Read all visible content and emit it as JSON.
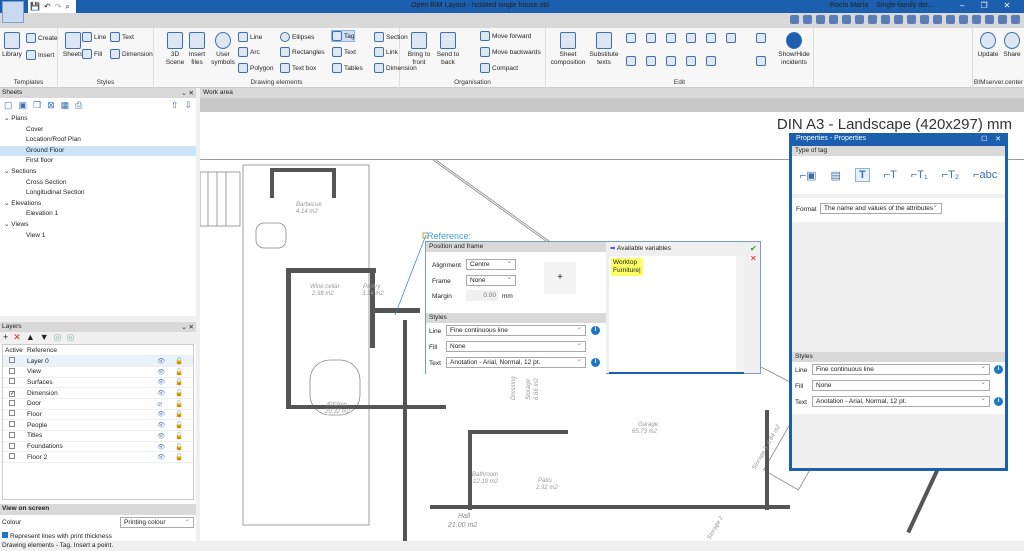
{
  "app": {
    "title": "Open BIM Layout - Isolated single house.obl",
    "user": "Rocío María",
    "project": "Single-family det...",
    "window_buttons": [
      "–",
      "❐",
      "✕"
    ]
  },
  "ribbon": {
    "templates": {
      "label": "Templates",
      "library": "Library",
      "create": "Create",
      "insert": "Insert"
    },
    "styles": {
      "label": "Styles",
      "sheets": "Sheets",
      "line": "Line",
      "fill": "Fill",
      "text": "Text",
      "dimension": "Dimension"
    },
    "drawing": {
      "label": "Drawing elements",
      "scene3d": "3D Scene",
      "insert_files": "Insert files",
      "user_symbols": "User symbols",
      "line": "Line",
      "arc": "Arc",
      "polygon": "Polygon",
      "ellipses": "Ellipses",
      "rectangles": "Rectangles",
      "textbox": "Text box",
      "tag": "Tag",
      "text": "Text",
      "tables": "Tables",
      "section": "Section",
      "link": "Link",
      "dimension": "Dimension"
    },
    "organisation": {
      "label": "Organisation",
      "bring_front": "Bring to front",
      "send_back": "Send to back",
      "move_forward": "Move forward",
      "move_backwards": "Move backwards",
      "compact": "Compact"
    },
    "edit": {
      "label": "Edit",
      "sheet_composition": "Sheet composition",
      "substitute_texts": "Substitute texts",
      "show_hide": "Show/Hide incidents"
    },
    "bim": {
      "label": "BIMserver.center",
      "update": "Update",
      "share": "Share"
    }
  },
  "sheets": {
    "title": "Sheets",
    "tree": [
      {
        "label": "Plans",
        "items": [
          "Cover",
          "Location/Roof Plan",
          "Ground Floor",
          "First floor"
        ]
      },
      {
        "label": "Sections",
        "items": [
          "Cross Section",
          "Longitudinal Section"
        ]
      },
      {
        "label": "Elevations",
        "items": [
          "Elevation 1"
        ]
      },
      {
        "label": "Views",
        "items": [
          "View 1"
        ]
      }
    ],
    "selected": "Ground Floor"
  },
  "layers": {
    "title": "Layers",
    "col_active": "Active",
    "col_reference": "Reference",
    "rows": [
      {
        "name": "Layer 0",
        "active": false,
        "visible": true
      },
      {
        "name": "View",
        "active": false,
        "visible": true
      },
      {
        "name": "Surfaces",
        "active": false,
        "visible": true
      },
      {
        "name": "Dimension",
        "active": true,
        "visible": true
      },
      {
        "name": "Door",
        "active": false,
        "visible": false
      },
      {
        "name": "Floor",
        "active": false,
        "visible": true
      },
      {
        "name": "People",
        "active": false,
        "visible": true
      },
      {
        "name": "Titles",
        "active": false,
        "visible": true
      },
      {
        "name": "Foundations",
        "active": false,
        "visible": true
      },
      {
        "name": "Floor 2",
        "active": false,
        "visible": true
      }
    ]
  },
  "view_on_screen": {
    "title": "View on screen",
    "colour_label": "Colour",
    "colour_value": "Printing colour",
    "represent_lines": "Represent lines with print thickness",
    "represent_checked": true
  },
  "status": "Drawing elements - Tag. Insert a point.",
  "work_area": {
    "title": "Work area",
    "sheet_format": "DIN A3 - Landscape (420x297) mm",
    "reference_label": "Reference:"
  },
  "rooms": [
    {
      "name": "Barbecue",
      "area": "4.14 m2"
    },
    {
      "name": "Wine cellar",
      "area": "2.38 m2"
    },
    {
      "name": "Pantry",
      "area": "3.34 m2"
    },
    {
      "name": "Kitchen",
      "area": "20.32 m2"
    },
    {
      "name": "Dressing",
      "area": ""
    },
    {
      "name": "Storage",
      "area": "6.66 m2"
    },
    {
      "name": "Garage",
      "area": "65.73 m2"
    },
    {
      "name": "Storage 3",
      "area": "6.84 m2"
    },
    {
      "name": "Bathroom",
      "area": "12.19 m2"
    },
    {
      "name": "Patio",
      "area": "2.92 m2"
    },
    {
      "name": "Hall",
      "area": "21.00 m2"
    },
    {
      "name": "Storage 2",
      "area": ""
    }
  ],
  "tag_editor": {
    "position_frame": "Position and frame",
    "alignment_label": "Alignment",
    "alignment": "Centre",
    "frame_label": "Frame",
    "frame": "None",
    "margin_label": "Margin",
    "margin": "0.00",
    "margin_unit": "mm",
    "styles": "Styles",
    "line_label": "Line",
    "line": "Fine continuous line",
    "fill_label": "Fill",
    "fill": "None",
    "text_label": "Text",
    "text": "Anotation - Arial, Normal, 12 pt.",
    "available_variables": "Available variables",
    "content_line1": "Worktop",
    "content_line2": "Furniture"
  },
  "properties": {
    "title": "Properties - Properties",
    "type_of_tag": "Type of tag",
    "format_label": "Format",
    "format": "The name and values of the attributes",
    "styles": "Styles",
    "line_label": "Line",
    "line": "Fine continuous line",
    "fill_label": "Fill",
    "fill": "None",
    "text_label": "Text",
    "text": "Anotation - Arial, Normal, 12 pt."
  }
}
